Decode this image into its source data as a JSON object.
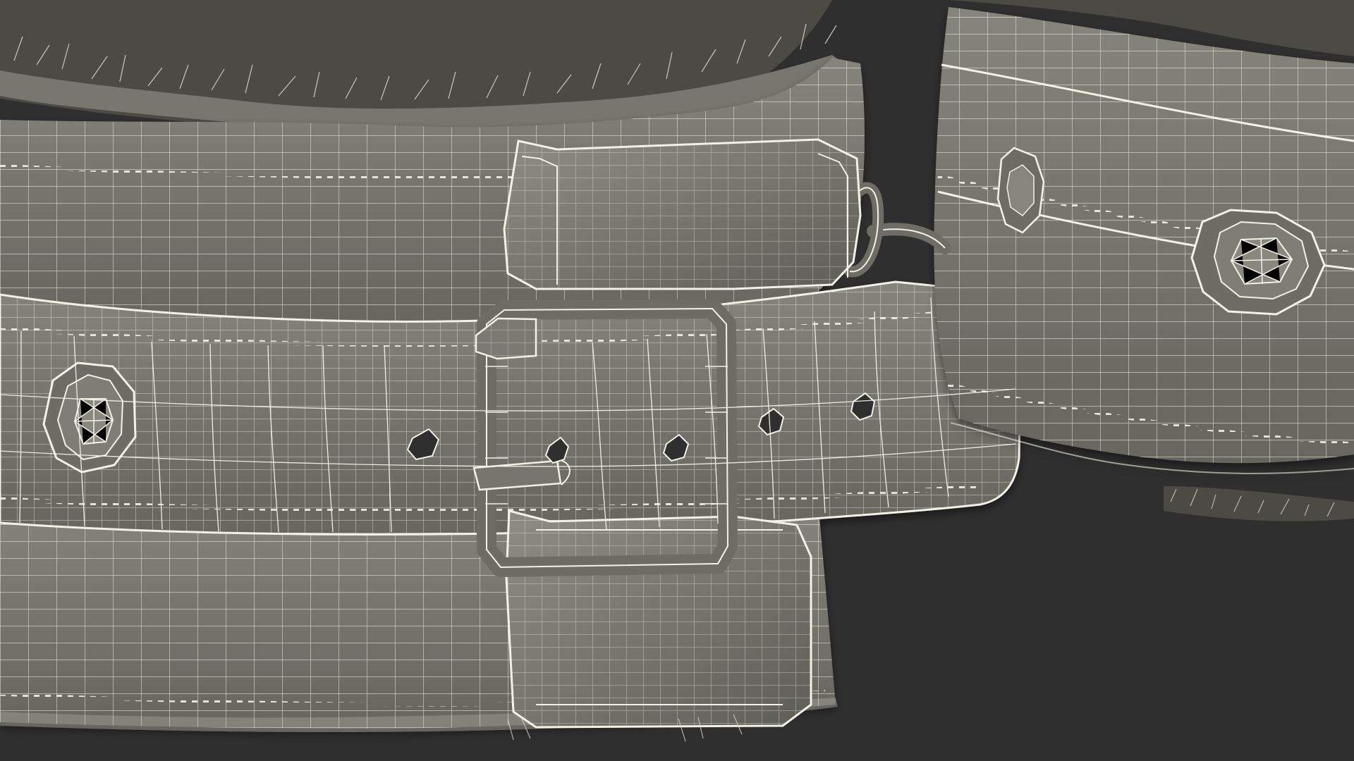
{
  "scene": {
    "background": "#2f2f2f",
    "model_color": "#77776f",
    "model_shadow": "#60605a",
    "model_highlight": "#8b8b82",
    "wire_color": "#f2f1e6",
    "fur_color": "#d8d4c7",
    "fur_shadow": "#4b4a45"
  }
}
